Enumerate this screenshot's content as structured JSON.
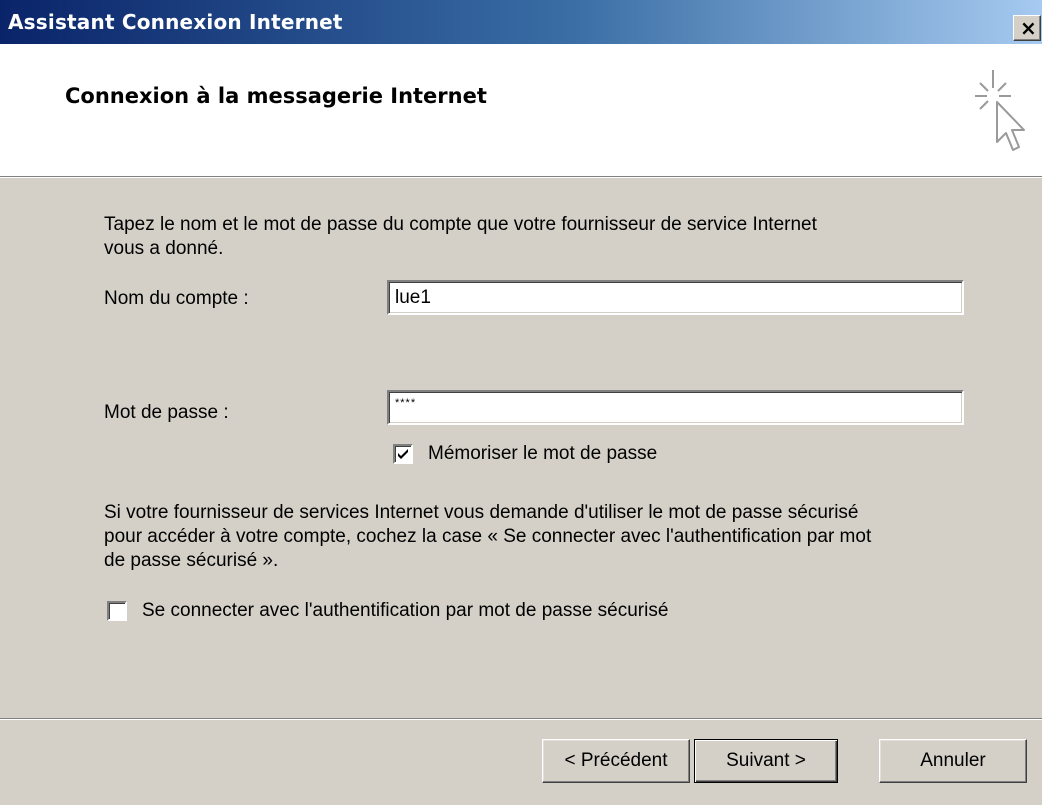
{
  "window": {
    "title": "Assistant Connexion Internet",
    "close_glyph": "✕"
  },
  "header": {
    "title": "Connexion à la messagerie Internet",
    "icon": "wizard-pointer-icon"
  },
  "body": {
    "intro_line1": "Tapez le nom et le mot de passe du compte que votre fournisseur de service Internet",
    "intro_line2": "vous a donné.",
    "account_label": "Nom du compte :",
    "account_value": "lue1",
    "password_label": "Mot de passe :",
    "password_value": "****",
    "remember_label": "Mémoriser le mot de passe",
    "remember_checked": true,
    "spa_note_line1": "Si votre fournisseur de services Internet vous demande d'utiliser le mot de passe sécurisé",
    "spa_note_line2": "pour accéder à votre compte, cochez la case « Se connecter avec l'authentification par mot",
    "spa_note_line3": "de passe sécurisé ».",
    "spa_label": "Se connecter avec l'authentification par mot de passe sécurisé",
    "spa_checked": false
  },
  "buttons": {
    "back": "< Précédent",
    "next": "Suivant >",
    "cancel": "Annuler"
  }
}
